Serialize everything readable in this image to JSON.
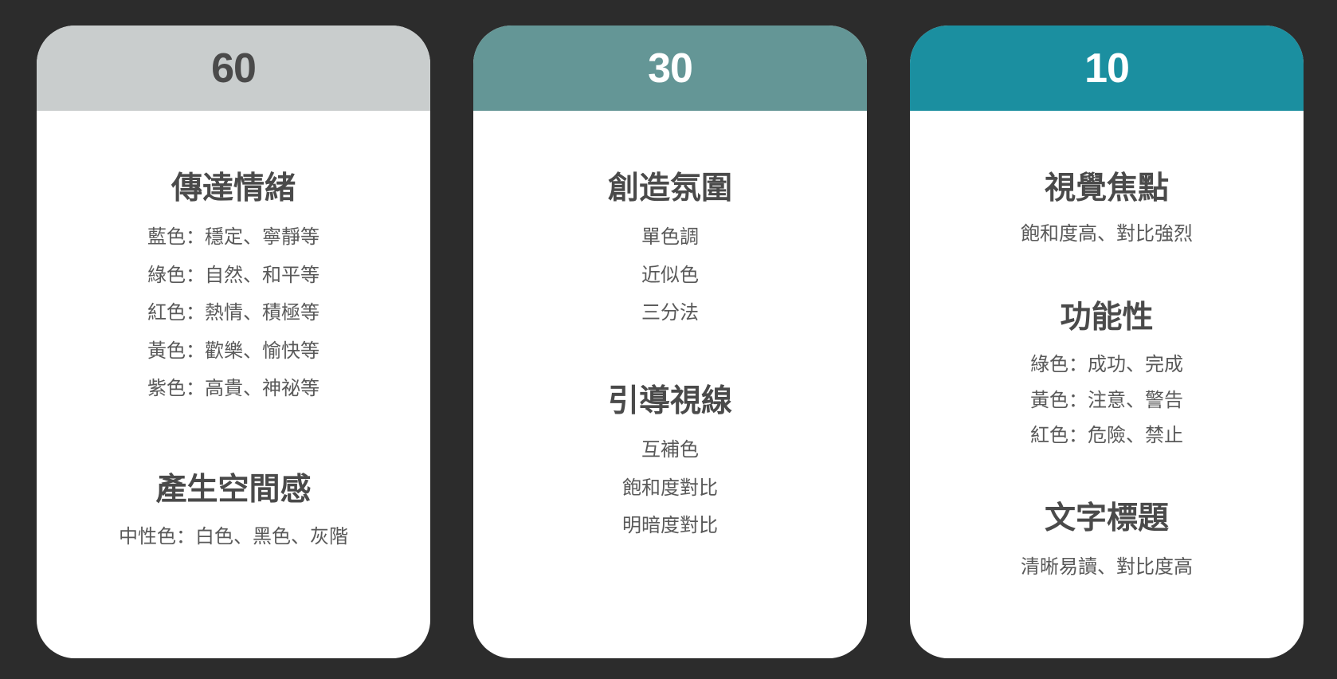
{
  "colors": {
    "background": "#2c2c2c",
    "card_60_header": "#c9cdcd",
    "card_60_number": "#4a4a4a",
    "card_30_header": "#649696",
    "card_10_header": "#1b8fa0",
    "heading_text": "#4a4a4a",
    "item_text": "#595959"
  },
  "cards": [
    {
      "number": "60",
      "sections": [
        {
          "title": "傳達情緒",
          "items": [
            "藍色：穩定、寧靜等",
            "綠色：自然、和平等",
            "紅色：熱情、積極等",
            "黃色：歡樂、愉快等",
            "紫色：高貴、神祕等"
          ]
        },
        {
          "title": "產生空間感",
          "items": [
            "中性色：白色、黑色、灰階"
          ]
        }
      ]
    },
    {
      "number": "30",
      "sections": [
        {
          "title": "創造氛圍",
          "items": [
            "單色調",
            "近似色",
            "三分法"
          ]
        },
        {
          "title": "引導視線",
          "items": [
            "互補色",
            "飽和度對比",
            "明暗度對比"
          ]
        }
      ]
    },
    {
      "number": "10",
      "sections": [
        {
          "title": "視覺焦點",
          "items": [
            "飽和度高、對比強烈"
          ]
        },
        {
          "title": "功能性",
          "items": [
            "綠色：成功、完成",
            "黃色：注意、警告",
            "紅色：危險、禁止"
          ]
        },
        {
          "title": "文字標題",
          "items": [
            "清晰易讀、對比度高"
          ]
        }
      ]
    }
  ]
}
